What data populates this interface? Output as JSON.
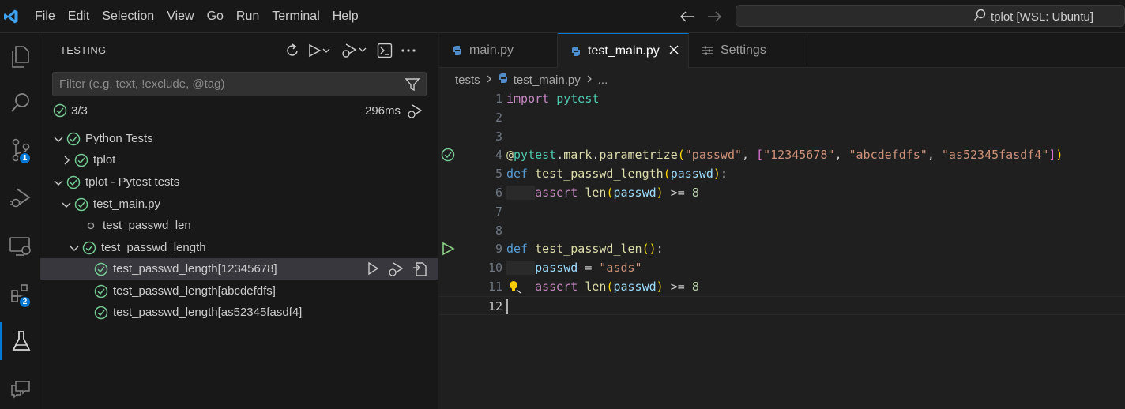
{
  "menu": [
    "File",
    "Edit",
    "Selection",
    "View",
    "Go",
    "Run",
    "Terminal",
    "Help"
  ],
  "command_center": {
    "label": "tplot [WSL: Ubuntu]"
  },
  "activity_badges": {
    "scm": "1",
    "extensions": "2"
  },
  "sidebar": {
    "title": "TESTING",
    "filter_placeholder": "Filter (e.g. text, !exclude, @tag)",
    "summary_count": "3/3",
    "summary_duration": "296ms",
    "tree": [
      {
        "label": "Python Tests",
        "level": 0,
        "chevron": "down",
        "status": "passed"
      },
      {
        "label": "tplot",
        "level": 1,
        "chevron": "right",
        "status": "passed"
      },
      {
        "label": "tplot - Pytest tests",
        "level": 0,
        "chevron": "down",
        "status": "passed"
      },
      {
        "label": "test_main.py",
        "level": 1,
        "chevron": "down",
        "status": "passed"
      },
      {
        "label": "test_passwd_len",
        "level": 2,
        "chevron": "none",
        "status": "unset"
      },
      {
        "label": "test_passwd_length",
        "level": 2,
        "chevron": "down",
        "status": "passed"
      },
      {
        "label": "test_passwd_length[12345678]",
        "level": 3,
        "chevron": "none",
        "status": "passed",
        "selected": true
      },
      {
        "label": "test_passwd_length[abcdefdfs]",
        "level": 3,
        "chevron": "none",
        "status": "passed"
      },
      {
        "label": "test_passwd_length[as52345fasdf4]",
        "level": 3,
        "chevron": "none",
        "status": "passed"
      }
    ]
  },
  "tabs": [
    {
      "label": "main.py",
      "active": false
    },
    {
      "label": "test_main.py",
      "active": true
    },
    {
      "label": "Settings",
      "active": false
    }
  ],
  "breadcrumbs": [
    "tests",
    "test_main.py",
    "..."
  ],
  "code": {
    "line_numbers": [
      "1",
      "2",
      "3",
      "4",
      "5",
      "6",
      "7",
      "8",
      "9",
      "10",
      "11",
      "12"
    ],
    "l1_kw": "import",
    "l1_mod": " pytest",
    "l4_at": "@",
    "l4_mod": "pytest",
    "l4_dot1": ".",
    "l4_mark": "mark",
    "l4_dot2": ".",
    "l4_fn": "parametrize",
    "l4_p1": "(",
    "l4_s1": "\"passwd\"",
    "l4_c1": ", ",
    "l4_b1": "[",
    "l4_s2": "\"12345678\"",
    "l4_c2": ", ",
    "l4_s3": "\"abcdefdfs\"",
    "l4_c3": ", ",
    "l4_s4": "\"as52345fasdf4\"",
    "l4_b2": "]",
    "l4_p2": ")",
    "l5_kw": "def",
    "l5_fn": " test_passwd_length",
    "l5_p1": "(",
    "l5_var": "passwd",
    "l5_p2": ")",
    "l5_colon": ":",
    "l6_kw": "assert",
    "l6_fn": " len",
    "l6_p1": "(",
    "l6_var": "passwd",
    "l6_p2": ")",
    "l6_op": " >= ",
    "l6_num": "8",
    "l9_kw": "def",
    "l9_fn": " test_passwd_len",
    "l9_p": "()",
    "l9_colon": ":",
    "l10_var": "passwd",
    "l10_op": " = ",
    "l10_str": "\"asds\"",
    "l11_kw": "assert",
    "l11_fn": " len",
    "l11_p1": "(",
    "l11_var": "passwd",
    "l11_p2": ")",
    "l11_op": " >= ",
    "l11_num": "8"
  },
  "colors": {
    "accent": "#0078d4",
    "passed": "#73c991",
    "run": "#89d185"
  }
}
